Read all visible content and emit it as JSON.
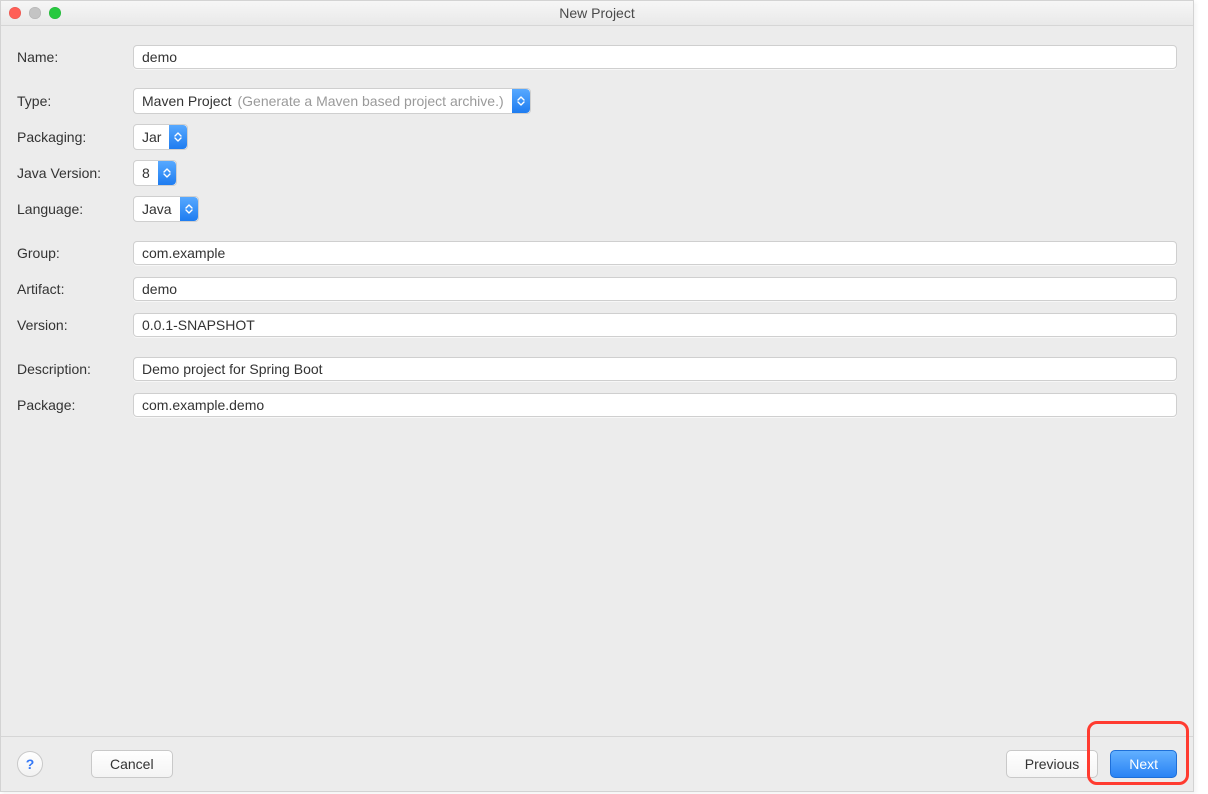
{
  "window": {
    "title": "New Project"
  },
  "labels": {
    "name": "Name:",
    "type": "Type:",
    "packaging": "Packaging:",
    "java_version": "Java Version:",
    "language": "Language:",
    "group": "Group:",
    "artifact": "Artifact:",
    "version": "Version:",
    "description": "Description:",
    "package": "Package:"
  },
  "values": {
    "name": "demo",
    "type": "Maven Project",
    "type_hint": "(Generate a Maven based project archive.)",
    "packaging": "Jar",
    "java_version": "8",
    "language": "Java",
    "group": "com.example",
    "artifact": "demo",
    "version": "0.0.1-SNAPSHOT",
    "description": "Demo project for Spring Boot",
    "package": "com.example.demo"
  },
  "buttons": {
    "help": "?",
    "cancel": "Cancel",
    "previous": "Previous",
    "next": "Next"
  }
}
